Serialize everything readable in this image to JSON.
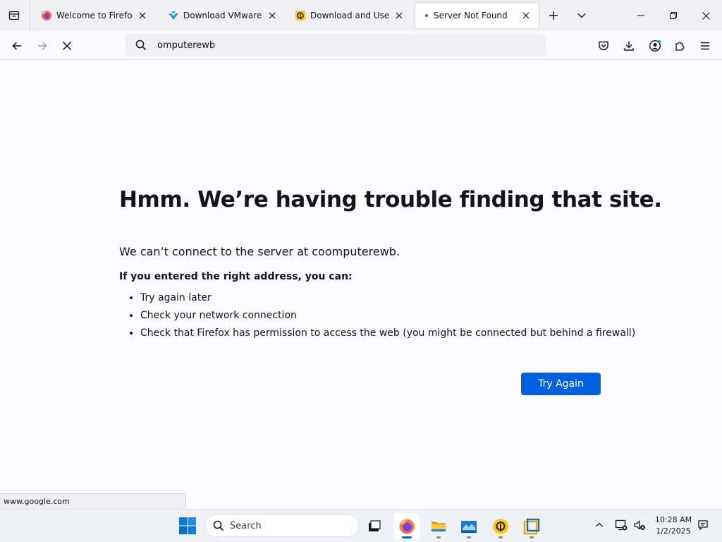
{
  "tabs": [
    {
      "title": "Welcome to Firefox",
      "icon": "firefox-icon",
      "active": false
    },
    {
      "title": "Download VMware Wo",
      "icon": "vmware-download-icon",
      "active": false
    },
    {
      "title": "Download and Use LDP",
      "icon": "ldplayer-icon",
      "active": false
    },
    {
      "title": "Server Not Found",
      "icon": "loading-dot-icon",
      "active": true
    }
  ],
  "navbar": {
    "url_value": "omputerewb"
  },
  "error_page": {
    "title": "Hmm. We’re having trouble finding that site.",
    "description": "We can’t connect to the server at coomputerewb.",
    "lead": "If you entered the right address, you can:",
    "suggestions": [
      "Try again later",
      "Check your network connection",
      "Check that Firefox has permission to access the web (you might be connected but behind a firewall)"
    ],
    "try_again_label": "Try Again"
  },
  "status_bar": {
    "url": "www.google.com"
  },
  "taskbar": {
    "search_label": "Search",
    "time": "10:28 AM",
    "date": "1/2/2025"
  },
  "colors": {
    "accent": "#0061e0",
    "tab_strip": "#f0f0f4",
    "page_bg": "#fbfbfe"
  }
}
